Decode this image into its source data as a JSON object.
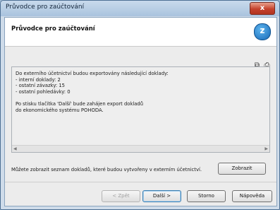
{
  "window": {
    "title": "Průvodce pro zaúčtování",
    "close_label": "x"
  },
  "header": {
    "title": "Průvodce pro zaúčtování",
    "logo_icon": "pohoda-logo-icon",
    "logo_letter": "z"
  },
  "toolbar": {
    "icons": [
      "copy-icon",
      "print-icon"
    ],
    "copy_glyph": "⧉",
    "print_glyph": "⎙"
  },
  "message": {
    "lines": [
      "Do externího účetnictví budou exportovány následující doklady:",
      "- interní doklady: 2",
      "- ostatní závazky: 15",
      "- ostatní pohledávky: 0",
      "",
      "Po stisku tlačítka 'Další' bude zahájen export dokladů",
      "do ekonomického systému POHODA."
    ]
  },
  "info": {
    "text": "Můžete zobrazit seznam dokladů, které budou vytvořeny v externím účetnictví.",
    "show_button": "Zobrazit"
  },
  "footer": {
    "back": "< Zpět",
    "next": "Další >",
    "cancel": "Storno",
    "help": "Nápověda"
  }
}
